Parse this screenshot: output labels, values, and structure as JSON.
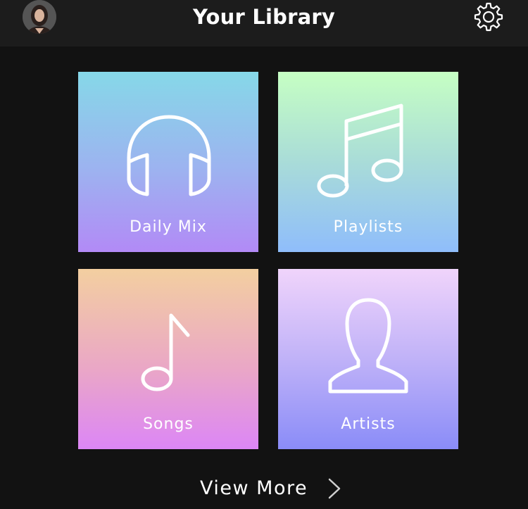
{
  "header": {
    "title": "Your Library",
    "avatar_icon": "user-avatar-photo",
    "settings_icon": "gear-icon"
  },
  "tiles": [
    {
      "label": "Daily Mix",
      "icon": "headphones-icon",
      "gradient": [
        "#86d8e8",
        "#b28af6"
      ]
    },
    {
      "label": "Playlists",
      "icon": "music-notes-icon",
      "gradient": [
        "#c6ffc3",
        "#8fbdfb"
      ]
    },
    {
      "label": "Songs",
      "icon": "music-note-icon",
      "gradient": [
        "#f3cfa0",
        "#dc86f6"
      ]
    },
    {
      "label": "Artists",
      "icon": "person-icon",
      "gradient": [
        "#f0d4fb",
        "#8a8cf8"
      ]
    }
  ],
  "footer": {
    "view_more_label": "View More",
    "chevron_icon": "chevron-right-icon"
  },
  "colors": {
    "background": "#121212",
    "header_background": "#1c1c1c",
    "text": "#ffffff"
  }
}
